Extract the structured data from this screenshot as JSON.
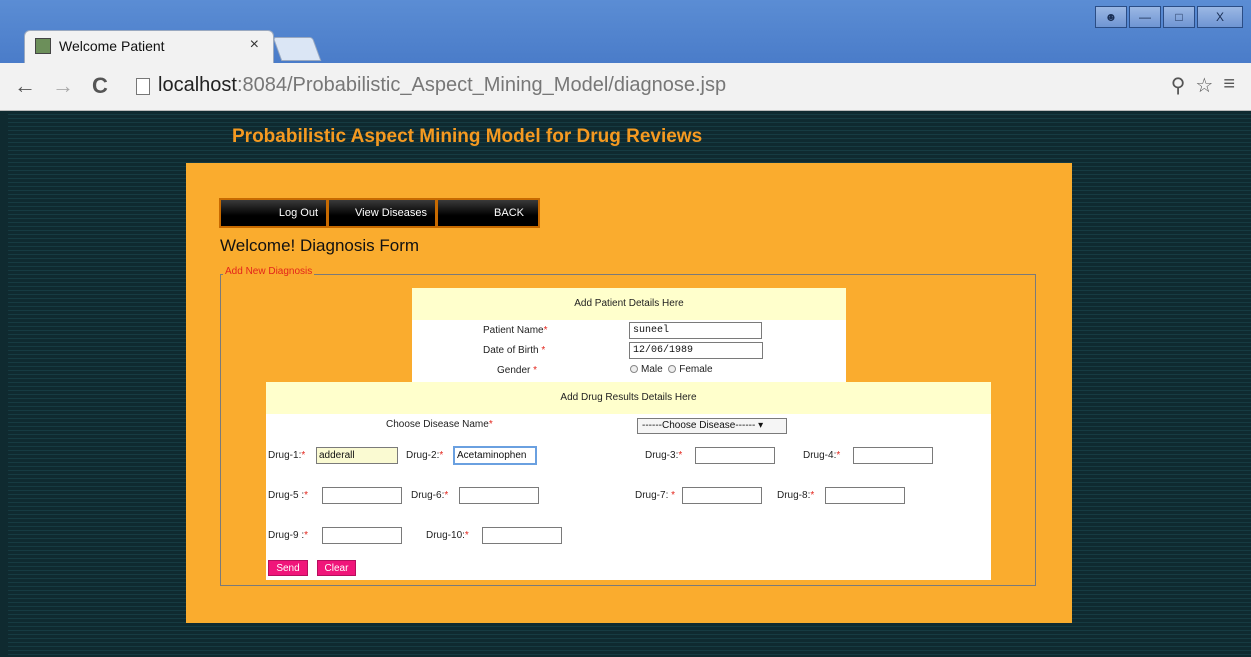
{
  "browser": {
    "tab_title": "Welcome Patient",
    "tab_close": "×",
    "url_host": "localhost",
    "url_path": ":8084/Probabilistic_Aspect_Mining_Model/diagnose.jsp",
    "back": "←",
    "forward": "→",
    "reload": "C",
    "zoom_icon": "zoom-out-icon",
    "star_icon": "star-icon",
    "menu_icon": "hamburger-icon"
  },
  "page": {
    "title": "Probabilistic Aspect Mining Model for Drug Reviews",
    "nav": {
      "logout": "Log Out",
      "view_diseases": "View Diseases",
      "back": "BACK"
    },
    "welcome": "Welcome! Diagnosis Form",
    "fieldset_legend": "Add New Diagnosis",
    "patient": {
      "heading": "Add Patient Details Here",
      "name_label": "Patient Name",
      "name_value": "suneel",
      "dob_label": "Date of Birth",
      "dob_value": "12/06/1989",
      "gender_label": "Gender",
      "gender_male": "Male",
      "gender_female": "Female"
    },
    "drugs": {
      "heading": "Add Drug Results Details Here",
      "disease_label": "Choose Disease Name",
      "disease_selected": "------Choose Disease------",
      "labels": [
        "Drug-1:",
        "Drug-2:",
        "Drug-3:",
        "Drug-4:",
        "Drug-5 :",
        "Drug-6:",
        "Drug-7:",
        "Drug-8:",
        "Drug-9 :",
        "Drug-10:"
      ],
      "values": [
        "adderall",
        "Acetaminophen",
        "",
        "",
        "",
        "",
        "",
        "",
        "",
        ""
      ],
      "required_mark": "*"
    },
    "buttons": {
      "send": "Send",
      "clear": "Clear"
    }
  },
  "colors": {
    "page_bg": "#0f2a30",
    "panel": "#faac2e",
    "title": "#f59a21",
    "button": "#f0157a",
    "required": "#e3241b"
  }
}
